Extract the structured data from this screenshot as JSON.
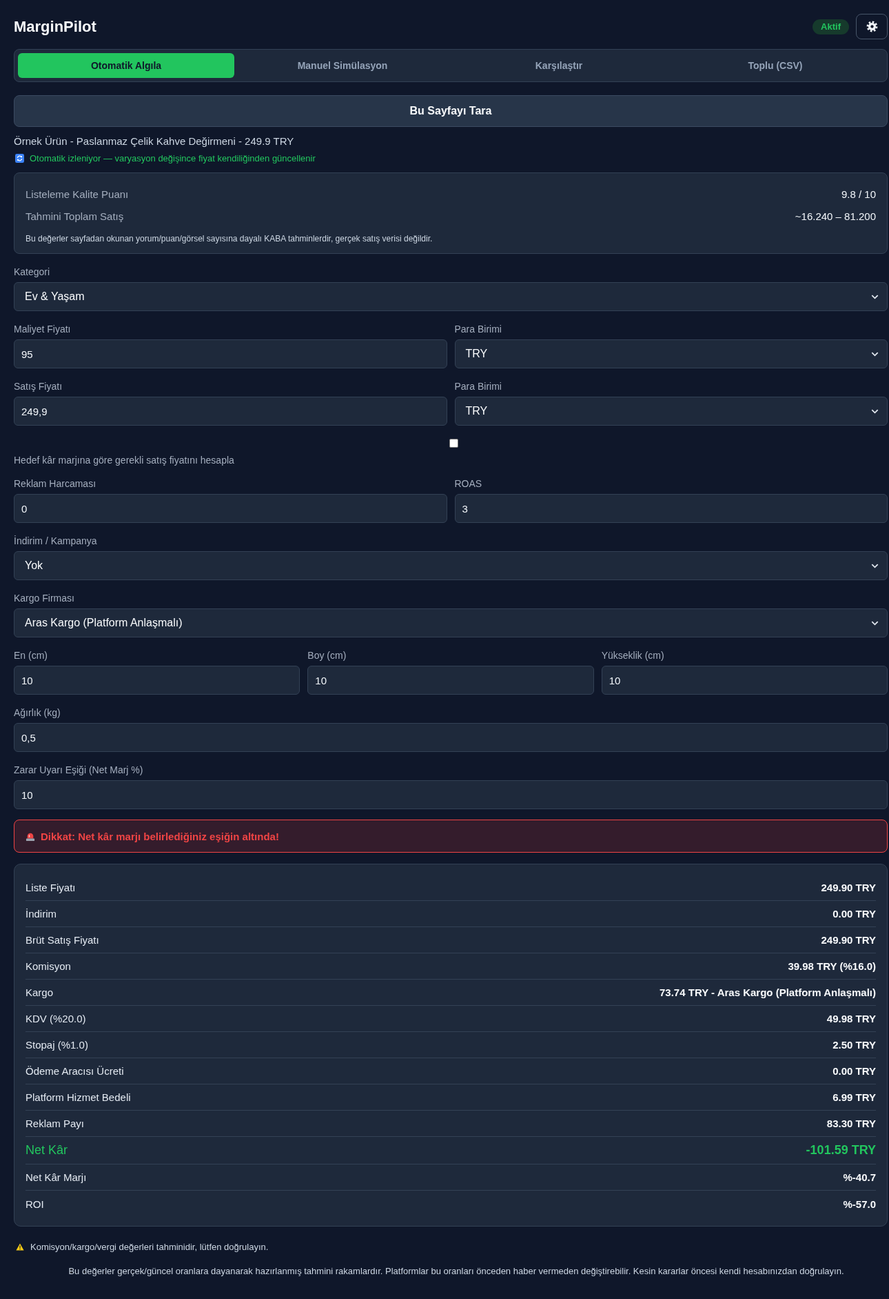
{
  "header": {
    "title": "MarginPilot",
    "status": "Aktif"
  },
  "tabs": [
    {
      "label": "Otomatik Algıla",
      "selected": true
    },
    {
      "label": "Manuel Simülasyon",
      "selected": false
    },
    {
      "label": "Karşılaştır",
      "selected": false
    },
    {
      "label": "Toplu (CSV)",
      "selected": false
    }
  ],
  "scan_button": "Bu Sayfayı Tara",
  "product": {
    "summary": "Örnek Ürün - Paslanmaz Çelik Kahve Değirmeni - 249.9 TRY",
    "tracking": "Otomatik izleniyor — varyasyon değişince fiyat kendiliğinden güncellenir"
  },
  "insights": {
    "rows": [
      {
        "label": "Listeleme Kalite Puanı",
        "value": "9.8 / 10"
      },
      {
        "label": "Tahmini Toplam Satış",
        "value": "~16.240 – 81.200"
      }
    ],
    "note": "Bu değerler sayfadan okunan yorum/puan/görsel sayısına dayalı KABA tahminlerdir, gerçek satış verisi değildir."
  },
  "form": [
    {
      "kind": "fields",
      "fields": [
        {
          "kind": "select",
          "label": "Kategori",
          "value": "Ev & Yaşam"
        }
      ]
    },
    {
      "kind": "fields",
      "fields": [
        {
          "kind": "input",
          "label": "Maliyet Fiyatı",
          "value": "95"
        },
        {
          "kind": "select",
          "label": "Para Birimi",
          "value": "TRY"
        }
      ]
    },
    {
      "kind": "fields",
      "fields": [
        {
          "kind": "input",
          "label": "Satış Fiyatı",
          "value": "249,9"
        },
        {
          "kind": "select",
          "label": "Para Birimi",
          "value": "TRY"
        }
      ]
    },
    {
      "kind": "checkbox",
      "label": "Hedef kâr marjına göre gerekli satış fiyatını hesapla",
      "checked": false
    },
    {
      "kind": "fields",
      "fields": [
        {
          "kind": "input",
          "label": "Reklam Harcaması",
          "value": "0"
        },
        {
          "kind": "input",
          "label": "ROAS",
          "value": "3"
        }
      ]
    },
    {
      "kind": "fields",
      "fields": [
        {
          "kind": "select",
          "label": "İndirim / Kampanya",
          "value": "Yok"
        }
      ]
    },
    {
      "kind": "fields",
      "fields": [
        {
          "kind": "select",
          "label": "Kargo Firması",
          "value": "Aras Kargo (Platform Anlaşmalı)"
        }
      ]
    },
    {
      "kind": "fields",
      "fields": [
        {
          "kind": "input",
          "label": "En (cm)",
          "value": "10"
        },
        {
          "kind": "input",
          "label": "Boy (cm)",
          "value": "10"
        },
        {
          "kind": "input",
          "label": "Yükseklik (cm)",
          "value": "10"
        }
      ]
    },
    {
      "kind": "fields",
      "fields": [
        {
          "kind": "input",
          "label": "Ağırlık (kg)",
          "value": "0,5"
        }
      ]
    },
    {
      "kind": "fields",
      "fields": [
        {
          "kind": "input",
          "label": "Zarar Uyarı Eşiği (Net Marj %)",
          "value": "10"
        }
      ]
    }
  ],
  "alert": {
    "text": "Dikkat: Net kâr marjı belirlediğiniz eşiğin altında!"
  },
  "results": [
    {
      "kind": "line",
      "label": "Liste Fiyatı",
      "value": "249.90 TRY"
    },
    {
      "kind": "line",
      "label": "İndirim",
      "value": "0.00 TRY"
    },
    {
      "kind": "line",
      "label": "Brüt Satış Fiyatı",
      "value": "249.90 TRY"
    },
    {
      "kind": "line",
      "label": "Komisyon",
      "value": "39.98 TRY (%16.0)"
    },
    {
      "kind": "line",
      "label": "Kargo",
      "value": "73.74 TRY - Aras Kargo (Platform Anlaşmalı)"
    },
    {
      "kind": "line",
      "label": "KDV (%20.0)",
      "value": "49.98 TRY"
    },
    {
      "kind": "line",
      "label": "Stopaj (%1.0)",
      "value": "2.50 TRY"
    },
    {
      "kind": "line",
      "label": "Ödeme Aracısı Ücreti",
      "value": "0.00 TRY"
    },
    {
      "kind": "line",
      "label": "Platform Hizmet Bedeli",
      "value": "6.99 TRY"
    },
    {
      "kind": "line",
      "label": "Reklam Payı",
      "value": "83.30 TRY"
    },
    {
      "kind": "total",
      "label": "Net Kâr",
      "value": "-101.59 TRY"
    },
    {
      "kind": "line",
      "label": "Net Kâr Marjı",
      "value": "%-40.7"
    },
    {
      "kind": "line",
      "label": "ROI",
      "value": "%-57.0"
    }
  ],
  "footer": {
    "warning": "Komisyon/kargo/vergi değerleri tahminidir, lütfen doğrulayın.",
    "disclaimer": "Bu değerler gerçek/güncel oranlara dayanarak hazırlanmış tahmini rakamlardır. Platformlar bu oranları önceden haber vermeden değiştirebilir. Kesin kararlar öncesi kendi hesabınızdan doğrulayın."
  }
}
